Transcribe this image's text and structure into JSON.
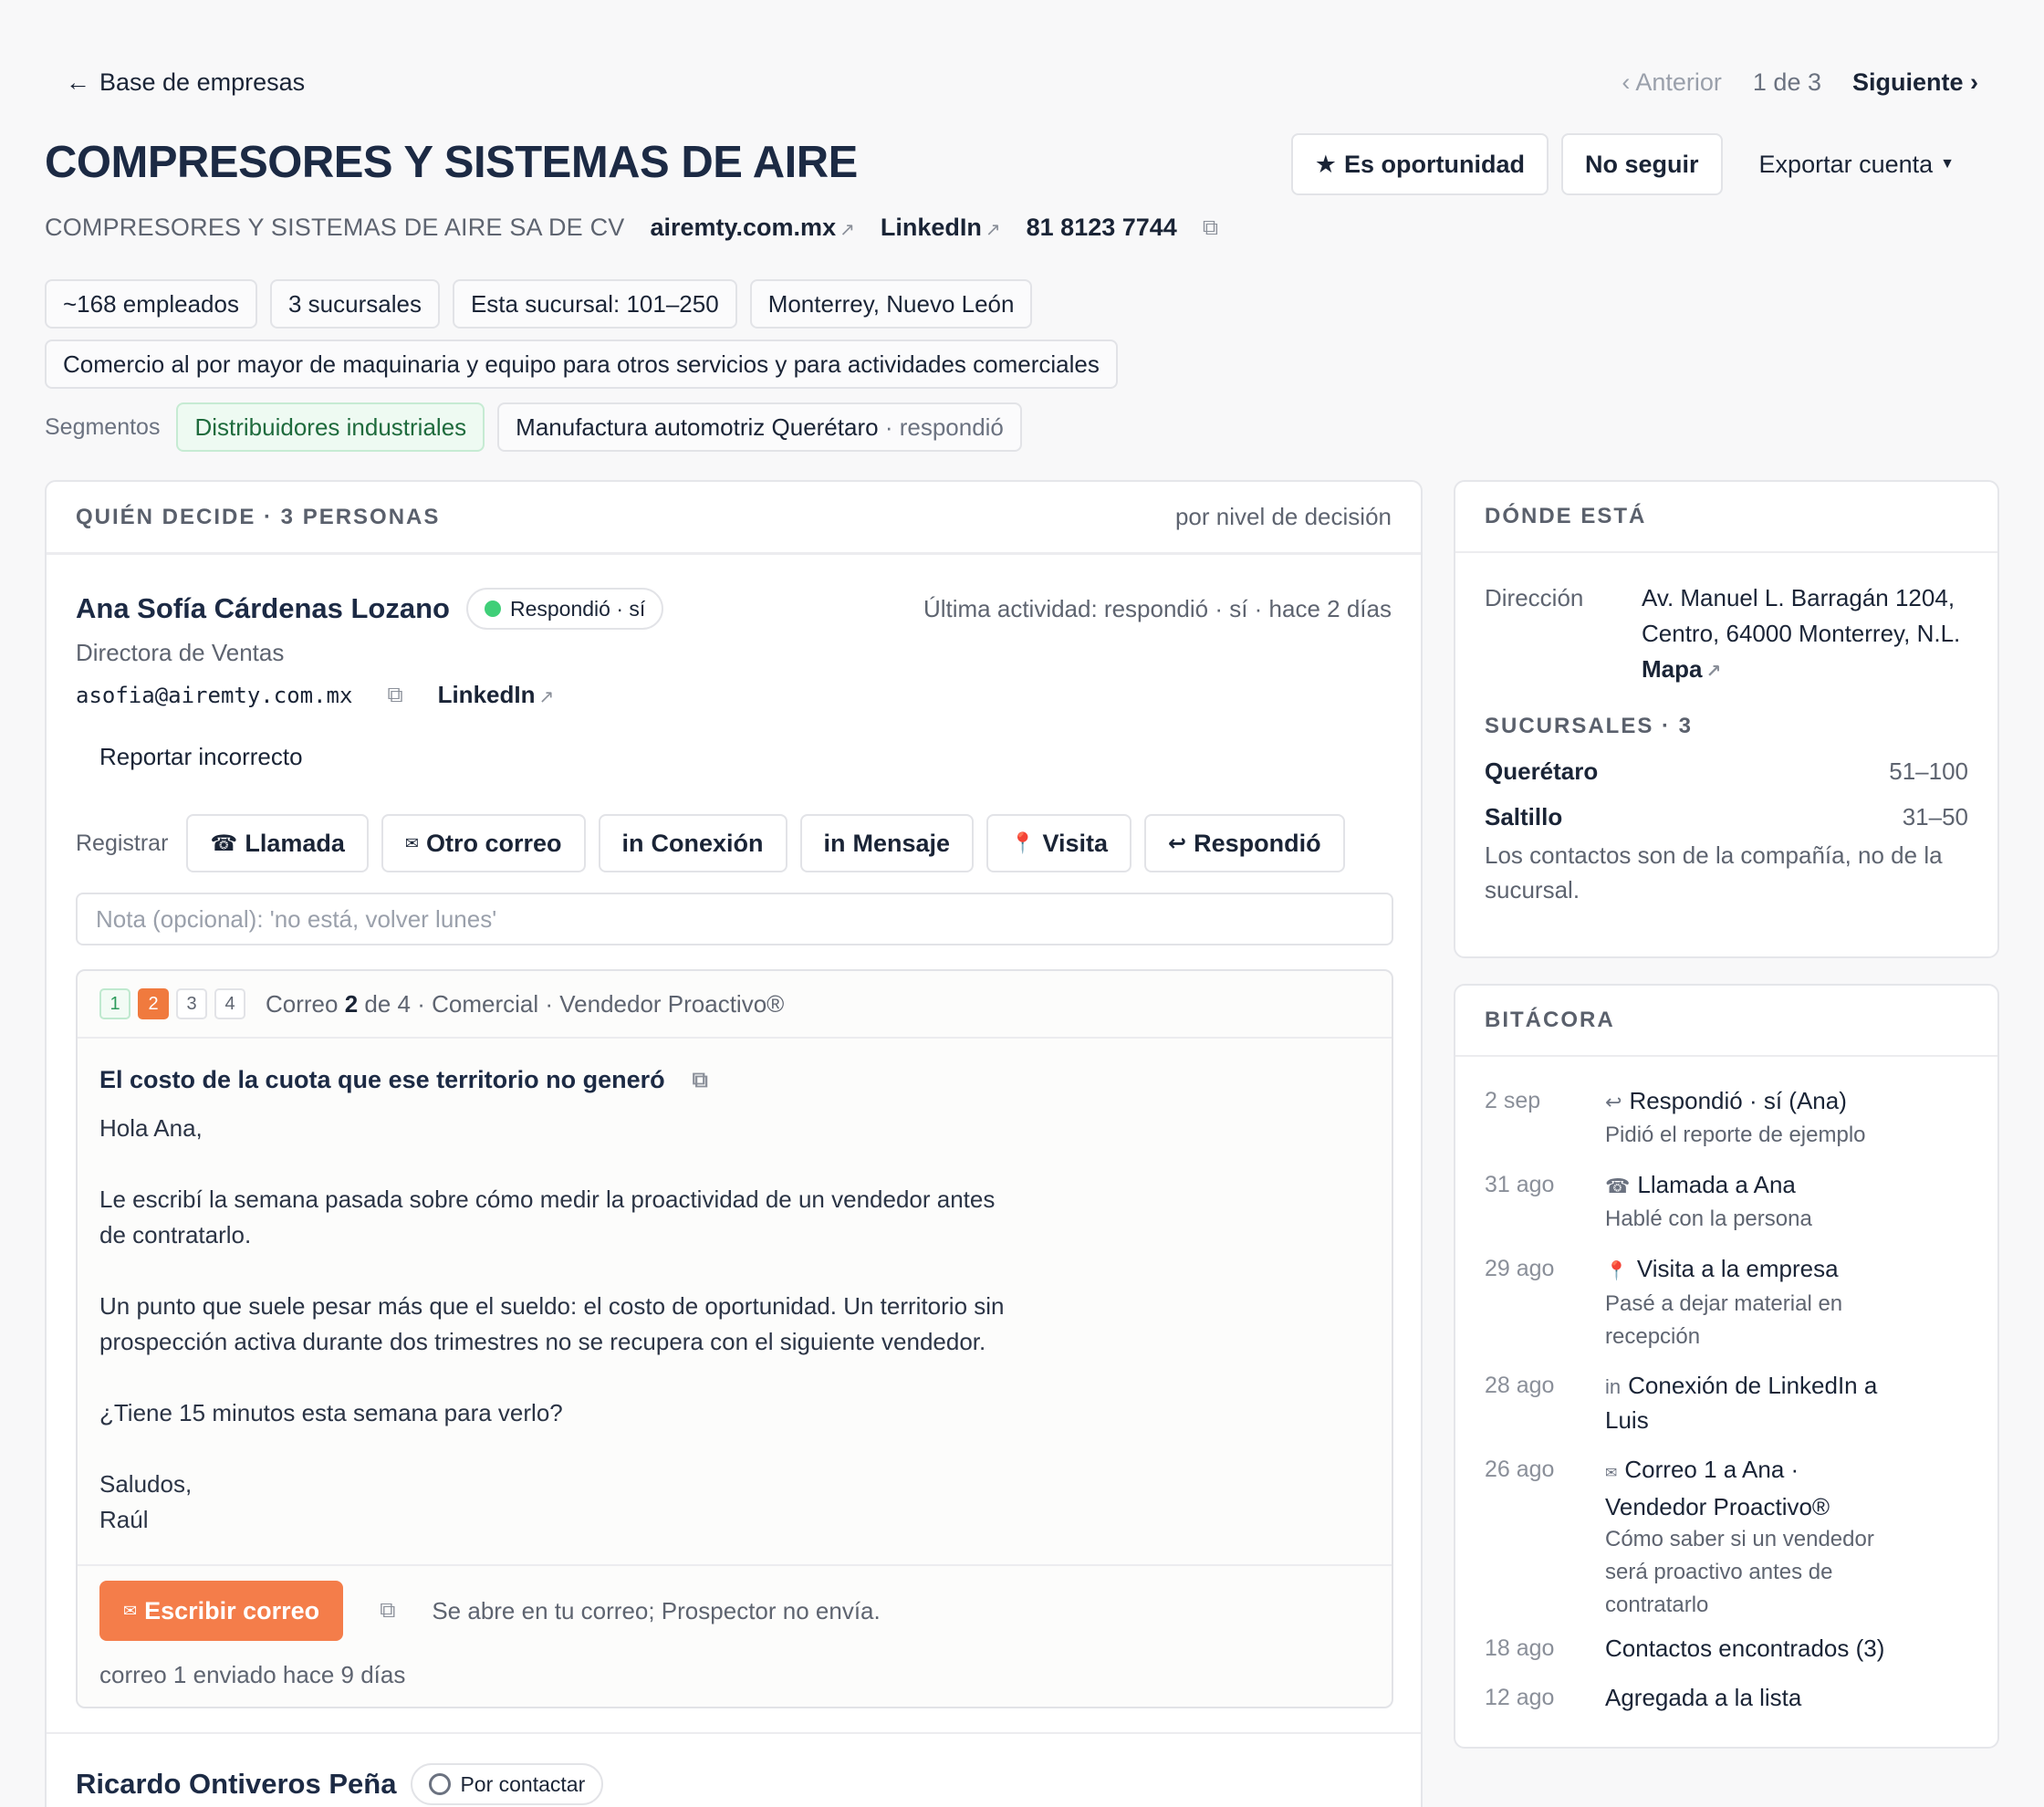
{
  "nav": {
    "back": "Base de empresas",
    "prev": "Anterior",
    "count": "1 de 3",
    "next": "Siguiente"
  },
  "company": {
    "name": "COMPRESORES Y SISTEMAS DE AIRE",
    "legal_name": "COMPRESORES Y SISTEMAS DE AIRE SA DE CV",
    "website": "airemty.com.mx",
    "linkedin": "LinkedIn",
    "phone": "81 8123 7744"
  },
  "actions": {
    "opportunity": "Es oportunidad",
    "unfollow": "No seguir",
    "export": "Exportar cuenta"
  },
  "facts": [
    "~168 empleados",
    "3 sucursales",
    "Esta sucursal: 101–250",
    "Monterrey, Nuevo León"
  ],
  "industry": "Comercio al por mayor de maquinaria y equipo para otros servicios y para actividades comerciales",
  "segments": {
    "label": "Segmentos",
    "items": [
      {
        "name": "Distribuidores industriales",
        "suffix": ""
      },
      {
        "name": "Manufactura automotriz Querétaro",
        "suffix": "· respondió"
      }
    ]
  },
  "deciders": {
    "title": "QUIÉN DECIDE · 3 PERSONAS",
    "sort": "por nivel de decisión",
    "person1": {
      "name": "Ana Sofía Cárdenas Lozano",
      "status": "Respondió · sí",
      "last_activity": "Última actividad: respondió · sí · hace 2 días",
      "role": "Directora de Ventas",
      "email": "asofia@airemty.com.mx",
      "linkedin": "LinkedIn",
      "report": "Reportar incorrecto"
    },
    "register": {
      "label": "Registrar",
      "buttons": [
        "Llamada",
        "Otro correo",
        "Conexión",
        "Mensaje",
        "Visita",
        "Respondió"
      ]
    },
    "note_placeholder": "Nota (opcional): 'no está, volver lunes'",
    "mail": {
      "steps": [
        "1",
        "2",
        "3",
        "4"
      ],
      "header_pre": "Correo ",
      "header_num": "2",
      "header_post": " de 4 · Comercial · Vendedor Proactivo®",
      "subject": "El costo de la cuota que ese territorio no generó",
      "greeting": "Hola Ana,",
      "p1": "Le escribí la semana pasada sobre cómo medir la proactividad de un vendedor antes\nde contratarlo.",
      "p2": "Un punto que suele pesar más que el sueldo: el costo de oportunidad. Un territorio sin\nprospección activa durante dos trimestres no se recupera con el siguiente vendedor.",
      "p3": "¿Tiene 15 minutos esta semana para verlo?",
      "sign": "Saludos,\nRaúl",
      "write_button": "Escribir correo",
      "hint": "Se abre en tu correo; Prospector no envía.",
      "sent": "correo 1 enviado hace 9 días"
    },
    "person2": {
      "name": "Ricardo Ontiveros Peña",
      "status": "Por contactar"
    }
  },
  "where": {
    "title": "DÓNDE ESTÁ",
    "address_label": "Dirección",
    "address": "Av. Manuel L. Barragán 1204, Centro, 64000 Monterrey, N.L.",
    "map": "Mapa",
    "branches_title": "SUCURSALES · 3",
    "branches": [
      {
        "name": "Querétaro",
        "range": "51–100"
      },
      {
        "name": "Saltillo",
        "range": "31–50"
      }
    ],
    "note": "Los contactos son de la compañía, no de la sucursal."
  },
  "log": {
    "title": "BITÁCORA",
    "entries": [
      {
        "date": "2 sep",
        "icon": "reply-icon",
        "text": "Respondió · sí (Ana)",
        "sub": "Pidió el reporte de ejemplo"
      },
      {
        "date": "31 ago",
        "icon": "phone-icon",
        "text": "Llamada a Ana",
        "sub": "Hablé con la persona"
      },
      {
        "date": "29 ago",
        "icon": "pin-icon",
        "text": "Visita a la empresa",
        "sub": "Pasé a dejar material en recepción"
      },
      {
        "date": "28 ago",
        "icon": "linkedin-icon",
        "text": "Conexión de LinkedIn a Luis",
        "sub": ""
      },
      {
        "date": "26 ago",
        "icon": "mail-icon",
        "text": "Correo 1 a Ana · Vendedor Proactivo®",
        "sub": "Cómo saber si un vendedor será proactivo antes de contratarlo"
      },
      {
        "date": "18 ago",
        "icon": "",
        "text": "Contactos encontrados (3)",
        "sub": ""
      },
      {
        "date": "12 ago",
        "icon": "",
        "text": "Agregada a la lista",
        "sub": ""
      }
    ]
  },
  "colors": {
    "accent": "#f47d4a",
    "success": "#3fcf78",
    "text": "#1a2436"
  }
}
